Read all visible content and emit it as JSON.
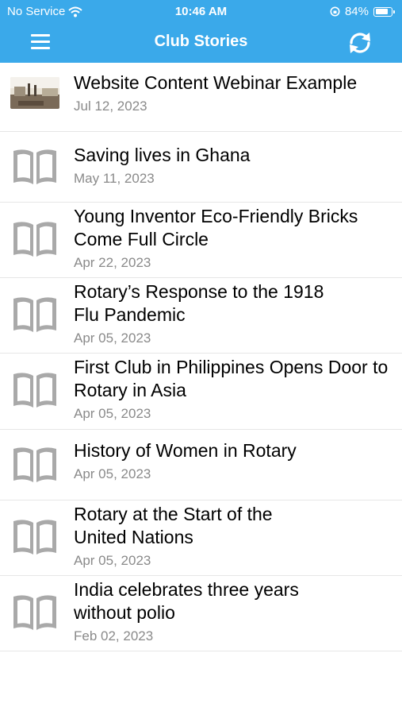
{
  "status_bar": {
    "carrier": "No Service",
    "time": "10:46 AM",
    "battery": "84%",
    "battery_level": 0.84
  },
  "nav": {
    "title": "Club Stories"
  },
  "stories": [
    {
      "title": "Website Content Webinar Example",
      "date": "Jul 12, 2023",
      "thumbnail": "photo"
    },
    {
      "title": "Saving lives in Ghana",
      "date": "May 11, 2023",
      "thumbnail": "book-icon"
    },
    {
      "title": "Young Inventor Eco-Friendly Bricks Come Full Circle",
      "date": "Apr 22, 2023",
      "thumbnail": "book-icon"
    },
    {
      "title": "Rotary’s Response to the 1918 Flu Pandemic",
      "date": "Apr 05, 2023",
      "thumbnail": "book-icon"
    },
    {
      "title": "First Club in Philippines Opens Door to Rotary in Asia",
      "date": "Apr 05, 2023",
      "thumbnail": "book-icon"
    },
    {
      "title": "History of Women in Rotary",
      "date": "Apr 05, 2023",
      "thumbnail": "book-icon"
    },
    {
      "title": "Rotary at the Start of the United Nations",
      "date": "Apr 05, 2023",
      "thumbnail": "book-icon"
    },
    {
      "title": "India celebrates three years without polio",
      "date": "Feb 02, 2023",
      "thumbnail": "book-icon"
    }
  ],
  "colors": {
    "header": "#3aa9ea",
    "book_icon": "#a9a9a9",
    "date_text": "#8a8a8a"
  }
}
